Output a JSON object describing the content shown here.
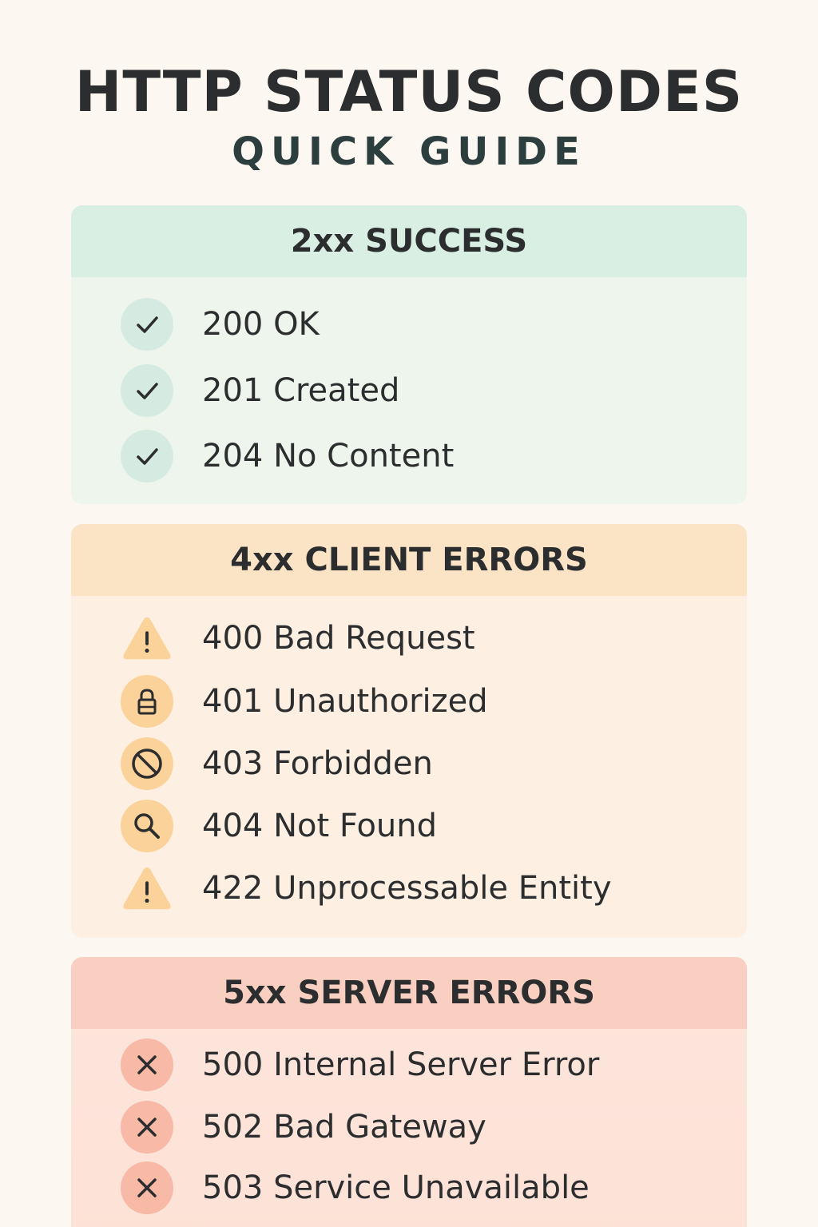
{
  "header": {
    "title": "HTTP STATUS CODES",
    "subtitle": "QUICK GUIDE"
  },
  "colors": {
    "success": "#d9efe4",
    "client_errors": "#fbe3c6",
    "server_errors": "#f9cfc2"
  },
  "sections": [
    {
      "title": "2xx SUCCESS",
      "items": [
        {
          "label": "200 OK",
          "icon": "check-icon"
        },
        {
          "label": "201 Created",
          "icon": "check-icon"
        },
        {
          "label": "204 No Content",
          "icon": "check-icon"
        }
      ]
    },
    {
      "title": "4xx CLIENT ERRORS",
      "items": [
        {
          "label": "400 Bad Request",
          "icon": "warning-icon"
        },
        {
          "label": "401 Unauthorized",
          "icon": "lock-icon"
        },
        {
          "label": "403 Forbidden",
          "icon": "prohibited-icon"
        },
        {
          "label": "404 Not Found",
          "icon": "search-icon"
        },
        {
          "label": "422 Unprocessable Entity",
          "icon": "warning-icon"
        }
      ]
    },
    {
      "title": "5xx SERVER ERRORS",
      "items": [
        {
          "label": "500 Internal Server Error",
          "icon": "x-icon"
        },
        {
          "label": "502 Bad Gateway",
          "icon": "x-icon"
        },
        {
          "label": "503 Service Unavailable",
          "icon": "x-icon"
        }
      ]
    }
  ]
}
